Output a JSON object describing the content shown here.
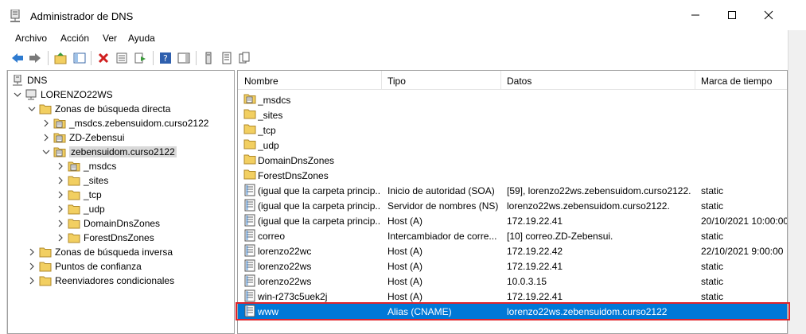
{
  "window": {
    "title": "Administrador de DNS",
    "icon": "dns-icon"
  },
  "menu": [
    "Archivo",
    "Acción",
    "Ver",
    "Ayuda"
  ],
  "tree": [
    {
      "label": "DNS",
      "icon": "dns-server-icon",
      "level": 0,
      "expander": "none"
    },
    {
      "label": "LORENZO22WS",
      "icon": "server-icon",
      "level": 1,
      "expander": "down"
    },
    {
      "label": "Zonas de búsqueda directa",
      "icon": "folder-icon",
      "level": 2,
      "expander": "down"
    },
    {
      "label": "_msdcs.zebensuidom.curso2122",
      "icon": "zone-icon",
      "level": 3,
      "expander": "right"
    },
    {
      "label": "ZD-Zebensui",
      "icon": "zone-icon",
      "level": 3,
      "expander": "right"
    },
    {
      "label": "zebensuidom.curso2122",
      "icon": "zone-icon",
      "level": 3,
      "expander": "down",
      "selected": true
    },
    {
      "label": "_msdcs",
      "icon": "zone-icon",
      "level": 4,
      "expander": "right"
    },
    {
      "label": "_sites",
      "icon": "folder-icon",
      "level": 4,
      "expander": "right"
    },
    {
      "label": "_tcp",
      "icon": "folder-icon",
      "level": 4,
      "expander": "right"
    },
    {
      "label": "_udp",
      "icon": "folder-icon",
      "level": 4,
      "expander": "right"
    },
    {
      "label": "DomainDnsZones",
      "icon": "folder-icon",
      "level": 4,
      "expander": "right"
    },
    {
      "label": "ForestDnsZones",
      "icon": "folder-icon",
      "level": 4,
      "expander": "right"
    },
    {
      "label": "Zonas de búsqueda inversa",
      "icon": "folder-icon",
      "level": 2,
      "expander": "right"
    },
    {
      "label": "Puntos de confianza",
      "icon": "folder-icon",
      "level": 2,
      "expander": "right"
    },
    {
      "label": "Reenviadores condicionales",
      "icon": "folder-icon",
      "level": 2,
      "expander": "right"
    }
  ],
  "columns": [
    "Nombre",
    "Tipo",
    "Datos",
    "Marca de tiempo"
  ],
  "records": [
    {
      "name": "_msdcs",
      "type": "",
      "data": "",
      "timestamp": "",
      "icon": "zone-icon"
    },
    {
      "name": "_sites",
      "type": "",
      "data": "",
      "timestamp": "",
      "icon": "folder-icon"
    },
    {
      "name": "_tcp",
      "type": "",
      "data": "",
      "timestamp": "",
      "icon": "folder-icon"
    },
    {
      "name": "_udp",
      "type": "",
      "data": "",
      "timestamp": "",
      "icon": "folder-icon"
    },
    {
      "name": "DomainDnsZones",
      "type": "",
      "data": "",
      "timestamp": "",
      "icon": "folder-icon"
    },
    {
      "name": "ForestDnsZones",
      "type": "",
      "data": "",
      "timestamp": "",
      "icon": "folder-icon"
    },
    {
      "name": "(igual que la carpeta princip...",
      "type": "Inicio de autoridad (SOA)",
      "data": "[59], lorenzo22ws.zebensuidom.curso2122...",
      "timestamp": "static",
      "icon": "record-icon"
    },
    {
      "name": "(igual que la carpeta princip...",
      "type": "Servidor de nombres (NS)",
      "data": "lorenzo22ws.zebensuidom.curso2122.",
      "timestamp": "static",
      "icon": "record-icon"
    },
    {
      "name": "(igual que la carpeta princip...",
      "type": "Host (A)",
      "data": "172.19.22.41",
      "timestamp": "20/10/2021 10:00:00",
      "icon": "record-icon"
    },
    {
      "name": "correo",
      "type": "Intercambiador de corre...",
      "data": "[10]  correo.ZD-Zebensui.",
      "timestamp": "static",
      "icon": "record-icon"
    },
    {
      "name": "lorenzo22wc",
      "type": "Host (A)",
      "data": "172.19.22.42",
      "timestamp": "22/10/2021 9:00:00",
      "icon": "record-icon"
    },
    {
      "name": "lorenzo22ws",
      "type": "Host (A)",
      "data": "172.19.22.41",
      "timestamp": "static",
      "icon": "record-icon"
    },
    {
      "name": "lorenzo22ws",
      "type": "Host (A)",
      "data": "10.0.3.15",
      "timestamp": "static",
      "icon": "record-icon"
    },
    {
      "name": "win-r273c5uek2j",
      "type": "Host (A)",
      "data": "172.19.22.41",
      "timestamp": "static",
      "icon": "record-icon"
    },
    {
      "name": "www",
      "type": "Alias (CNAME)",
      "data": "lorenzo22ws.zebensuidom.curso2122",
      "timestamp": "",
      "icon": "record-icon",
      "selected": true
    }
  ],
  "colors": {
    "selection": "#0078d7",
    "highlight": "#e0242b",
    "folder": "#f2cf61"
  }
}
